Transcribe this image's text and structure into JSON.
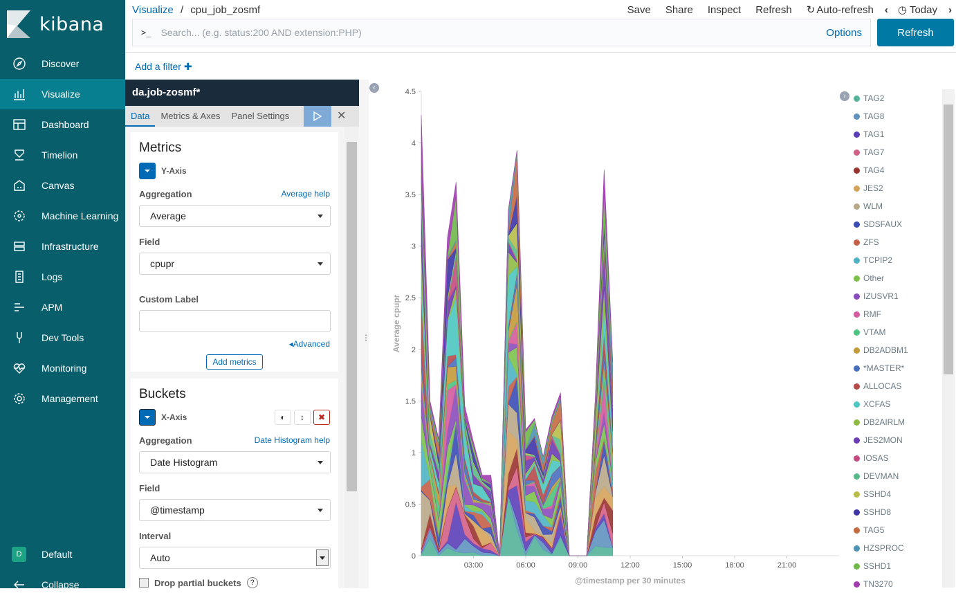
{
  "app": {
    "brand": "kibana",
    "nav": [
      {
        "label": "Discover",
        "icon": "compass-icon"
      },
      {
        "label": "Visualize",
        "icon": "visualize-icon",
        "active": true
      },
      {
        "label": "Dashboard",
        "icon": "dashboard-icon"
      },
      {
        "label": "Timelion",
        "icon": "timelion-icon"
      },
      {
        "label": "Canvas",
        "icon": "canvas-icon"
      },
      {
        "label": "Machine Learning",
        "icon": "machine-learning-icon"
      },
      {
        "label": "Infrastructure",
        "icon": "infrastructure-icon"
      },
      {
        "label": "Logs",
        "icon": "logs-icon"
      },
      {
        "label": "APM",
        "icon": "apm-icon"
      },
      {
        "label": "Dev Tools",
        "icon": "dev-tools-icon"
      },
      {
        "label": "Monitoring",
        "icon": "monitoring-icon"
      },
      {
        "label": "Management",
        "icon": "gear-icon"
      }
    ],
    "space": {
      "initial": "D",
      "label": "Default"
    },
    "collapse_label": "Collapse"
  },
  "header": {
    "breadcrumb_root": "Visualize",
    "breadcrumb_separator": "/",
    "breadcrumb_current": "cpu_job_zosmf",
    "actions": {
      "save": "Save",
      "share": "Share",
      "inspect": "Inspect",
      "refresh": "Refresh",
      "auto_refresh": "Auto-refresh",
      "time": "Today"
    }
  },
  "query": {
    "prompt": ">_",
    "placeholder": "Search... (e.g. status:200 AND extension:PHP)",
    "options_label": "Options",
    "refresh_label": "Refresh"
  },
  "filter_bar": {
    "add_filter_label": "Add a filter"
  },
  "editor": {
    "index_pattern": "da.job-zosmf*",
    "tabs": [
      "Data",
      "Metrics & Axes",
      "Panel Settings"
    ],
    "metrics": {
      "title": "Metrics",
      "agg_label": "Y-Axis",
      "aggregation_label": "Aggregation",
      "aggregation_help": "Average help",
      "aggregation_value": "Average",
      "field_label": "Field",
      "field_value": "cpupr",
      "custom_label_label": "Custom Label",
      "custom_label_value": "",
      "advanced_label": "Advanced",
      "add_metrics_label": "Add metrics"
    },
    "buckets": {
      "title": "Buckets",
      "agg_label": "X-Axis",
      "aggregation_label": "Aggregation",
      "aggregation_help": "Date Histogram help",
      "aggregation_value": "Date Histogram",
      "field_label": "Field",
      "field_value": "@timestamp",
      "interval_label": "Interval",
      "interval_value": "Auto",
      "drop_partial_label": "Drop partial buckets",
      "drop_partial_checked": false
    }
  },
  "chart_data": {
    "type": "area",
    "ylabel": "Average cpupr",
    "xlabel": "@timestamp per 30 minutes",
    "ylim": [
      0,
      4.5
    ],
    "yticks": [
      "0",
      "0.5",
      "1",
      "1.5",
      "2",
      "2.5",
      "3",
      "3.5",
      "4",
      "4.5"
    ],
    "xticks": [
      "03:00",
      "06:00",
      "09:00",
      "12:00",
      "15:00",
      "18:00",
      "21:00"
    ],
    "x": [
      "00:00",
      "00:30",
      "01:00",
      "01:30",
      "02:00",
      "02:30",
      "03:00",
      "03:30",
      "04:00",
      "04:30",
      "05:00",
      "05:30",
      "06:00",
      "06:30",
      "07:00",
      "07:30",
      "08:00",
      "08:30",
      "09:00",
      "09:30",
      "10:00",
      "10:30",
      "11:00"
    ],
    "totals": [
      4.27,
      1.5,
      1.13,
      3.08,
      3.62,
      1.45,
      1.1,
      0.78,
      0.78,
      0.0,
      3.35,
      3.93,
      1.22,
      1.33,
      0.96,
      1.35,
      1.58,
      0.0,
      0.0,
      0.0,
      1.55,
      3.74,
      1.88
    ],
    "legend_position": "right",
    "series": [
      {
        "name": "TAG2",
        "color": "#54b399"
      },
      {
        "name": "TAG8",
        "color": "#6092c0"
      },
      {
        "name": "TAG1",
        "color": "#5b3fb7"
      },
      {
        "name": "TAG7",
        "color": "#d36086"
      },
      {
        "name": "TAG4",
        "color": "#9a3431"
      },
      {
        "name": "JES2",
        "color": "#d6a35c"
      },
      {
        "name": "WLM",
        "color": "#b9a888"
      },
      {
        "name": "SDSFAUX",
        "color": "#3b4cb5"
      },
      {
        "name": "ZFS",
        "color": "#c65f48"
      },
      {
        "name": "TCPIP2",
        "color": "#4eb2c4"
      },
      {
        "name": "Other",
        "color": "#7cc24a"
      },
      {
        "name": "IZUSVR1",
        "color": "#8a4dbd"
      },
      {
        "name": "RMF",
        "color": "#d45a9f"
      },
      {
        "name": "VTAM",
        "color": "#4cc37f"
      },
      {
        "name": "DB2ADBM1",
        "color": "#c39a3a"
      },
      {
        "name": "*MASTER*",
        "color": "#4a6fbf"
      },
      {
        "name": "ALLOCAS",
        "color": "#b64a4a"
      },
      {
        "name": "XCFAS",
        "color": "#4cc6c0"
      },
      {
        "name": "DB2AIRLM",
        "color": "#8fbb45"
      },
      {
        "name": "JES2MON",
        "color": "#6a3cb5"
      },
      {
        "name": "IOSAS",
        "color": "#c54b7f"
      },
      {
        "name": "DEVMAN",
        "color": "#59b98a"
      },
      {
        "name": "SSHD4",
        "color": "#b8bd4a"
      },
      {
        "name": "SSHD8",
        "color": "#3d35a8"
      },
      {
        "name": "TAG5",
        "color": "#c46a3f"
      },
      {
        "name": "HZSPROC",
        "color": "#4c94b6"
      },
      {
        "name": "SSHD1",
        "color": "#6fb84a"
      },
      {
        "name": "TN3270",
        "color": "#a13cb0"
      }
    ]
  }
}
